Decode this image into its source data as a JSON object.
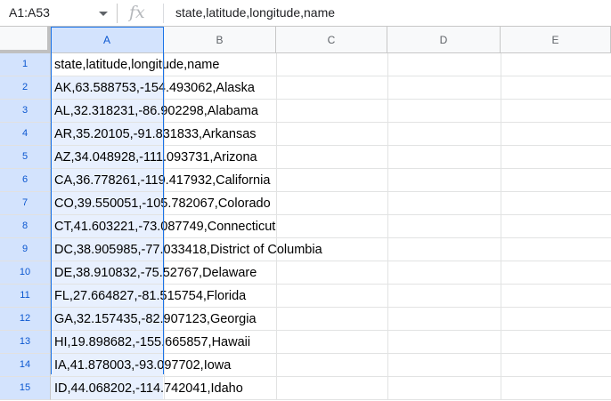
{
  "formula_bar": {
    "name_box": "A1:A53",
    "fx_label": "fx",
    "formula": "state,latitude,longitude,name"
  },
  "colors": {
    "selection": "#1a73e8",
    "selected_header_bg": "#d3e3fd",
    "selected_range_bg": "#e8f0fe"
  },
  "columns": [
    "A",
    "B",
    "C",
    "D",
    "E"
  ],
  "rows": [
    {
      "num": "1",
      "a": "state,latitude,longitude,name"
    },
    {
      "num": "2",
      "a": "AK,63.588753,-154.493062,Alaska"
    },
    {
      "num": "3",
      "a": "AL,32.318231,-86.902298,Alabama"
    },
    {
      "num": "4",
      "a": "AR,35.20105,-91.831833,Arkansas"
    },
    {
      "num": "5",
      "a": "AZ,34.048928,-111.093731,Arizona"
    },
    {
      "num": "6",
      "a": "CA,36.778261,-119.417932,California"
    },
    {
      "num": "7",
      "a": "CO,39.550051,-105.782067,Colorado"
    },
    {
      "num": "8",
      "a": "CT,41.603221,-73.087749,Connecticut"
    },
    {
      "num": "9",
      "a": "DC,38.905985,-77.033418,District of Columbia"
    },
    {
      "num": "10",
      "a": "DE,38.910832,-75.52767,Delaware"
    },
    {
      "num": "11",
      "a": "FL,27.664827,-81.515754,Florida"
    },
    {
      "num": "12",
      "a": "GA,32.157435,-82.907123,Georgia"
    },
    {
      "num": "13",
      "a": "HI,19.898682,-155.665857,Hawaii"
    },
    {
      "num": "14",
      "a": "IA,41.878003,-93.097702,Iowa"
    },
    {
      "num": "15",
      "a": "ID,44.068202,-114.742041,Idaho"
    }
  ]
}
